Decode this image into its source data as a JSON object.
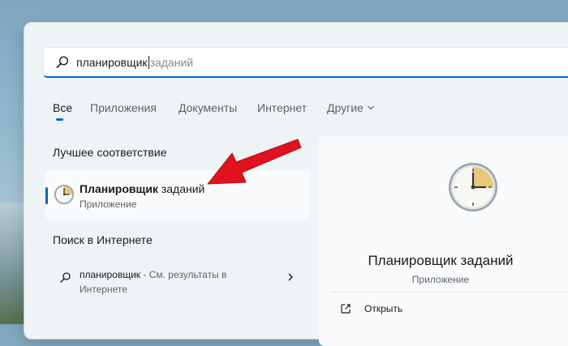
{
  "search": {
    "query_typed": "планировщик",
    "query_suggest": "заданий"
  },
  "tabs": [
    {
      "label": "Все",
      "active": true
    },
    {
      "label": "Приложения"
    },
    {
      "label": "Документы"
    },
    {
      "label": "Интернет"
    },
    {
      "label": "Другие"
    }
  ],
  "best_match": {
    "title": "Лучшее соответствие",
    "name_bold": "Планировщик",
    "name_rest": "заданий",
    "type": "Приложение"
  },
  "web": {
    "title": "Поиск в Интернете",
    "query": "планировщик",
    "hint": " - См. результаты в",
    "hint_line2": "Интернете"
  },
  "preview": {
    "title": "Планировщик заданий",
    "type": "Приложение",
    "open_label": "Открыть"
  },
  "colors": {
    "accent": "#0067c0",
    "annotation_arrow": "#e0121f",
    "clock_face_highlight": "#e8c97a"
  },
  "icons": {
    "search": "search-icon",
    "app": "task-scheduler-clock-icon",
    "web": "search-icon",
    "chevron": "chevron-right-icon",
    "open": "open-external-icon"
  }
}
